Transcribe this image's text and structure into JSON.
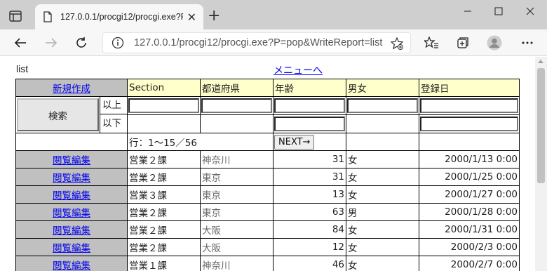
{
  "browser": {
    "tab_title": "127.0.0.1/procgi12/procgi.exe?P=",
    "tab_close": "✕",
    "new_tab": "+",
    "url": "127.0.0.1/procgi12/procgi.exe?P=pop&WriteReport=list",
    "icons": [
      "tab-actions-icon",
      "favicon-icon",
      "minimize-icon",
      "maximize-icon",
      "close-window-icon",
      "back-icon",
      "forward-icon",
      "refresh-icon",
      "site-info-icon",
      "add-favorite-icon",
      "favorites-icon",
      "collections-icon",
      "profile-icon",
      "more-icon"
    ]
  },
  "page": {
    "title": "list",
    "menu_link": "メニューへ",
    "table": {
      "new_link": "新規作成",
      "headers": [
        "Section",
        "都道府県",
        "年齢",
        "男女",
        "登録日"
      ],
      "search_button": "検索",
      "min_label": "以上",
      "max_label": "以下",
      "row_info": "行：1〜15／56",
      "next_button": "NEXT→",
      "rows": [
        {
          "action": "閲覧編集",
          "section": "営業２課",
          "pref": "神奈川",
          "age": "31",
          "sex": "女",
          "date": "2000/1/13 0:00"
        },
        {
          "action": "閲覧編集",
          "section": "営業２課",
          "pref": "東京",
          "age": "31",
          "sex": "女",
          "date": "2000/1/25 0:00"
        },
        {
          "action": "閲覧編集",
          "section": "営業３課",
          "pref": "東京",
          "age": "13",
          "sex": "女",
          "date": "2000/1/27 0:00"
        },
        {
          "action": "閲覧編集",
          "section": "営業２課",
          "pref": "東京",
          "age": "63",
          "sex": "男",
          "date": "2000/1/28 0:00"
        },
        {
          "action": "閲覧編集",
          "section": "営業２課",
          "pref": "大阪",
          "age": "84",
          "sex": "女",
          "date": "2000/1/31 0:00"
        },
        {
          "action": "閲覧編集",
          "section": "営業２課",
          "pref": "大阪",
          "age": "12",
          "sex": "女",
          "date": "2000/2/3 0:00"
        },
        {
          "action": "閲覧編集",
          "section": "営業１課",
          "pref": "神奈川",
          "age": "46",
          "sex": "女",
          "date": "2000/2/7 0:00"
        }
      ]
    }
  },
  "colors": {
    "header_bg": "#ffffcc",
    "action_bg": "#c0c0c0",
    "link": "#0000ee",
    "chrome_tabbar": "#cfcfcf"
  }
}
